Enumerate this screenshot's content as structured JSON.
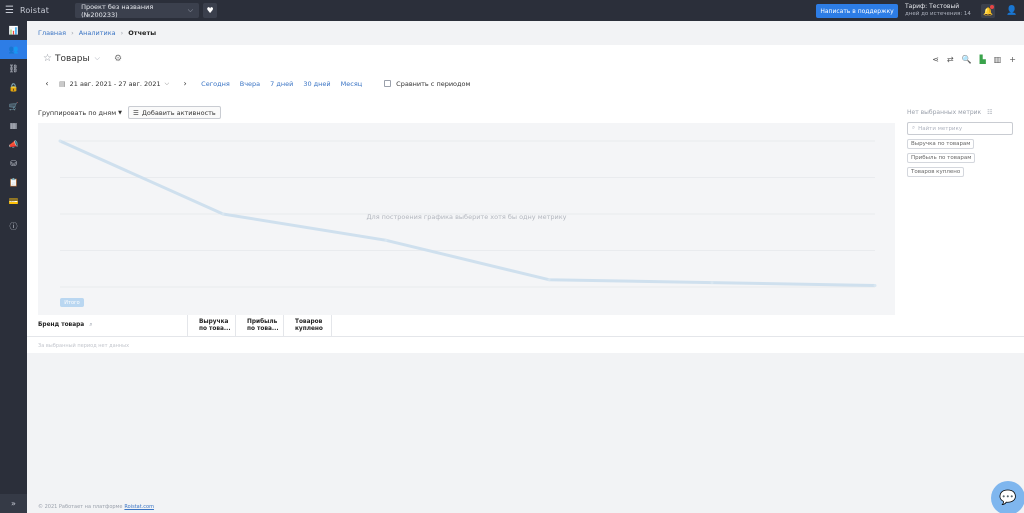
{
  "topbar": {
    "logo": "Roistat",
    "project": "Проект без названия (№200233)",
    "support_button": "Написать в поддержку",
    "tariff_title": "Тариф: Тестовый",
    "tariff_days": "дней до истечения: 14"
  },
  "sidebar": {
    "icons": [
      "analytics-icon",
      "user-group-icon",
      "sitemap-icon",
      "lock-icon",
      "cart-icon",
      "calendar-icon",
      "megaphone-icon",
      "database-icon",
      "table-edit-icon",
      "money-icon",
      "info-icon"
    ],
    "active_index": 1
  },
  "breadcrumb": {
    "home": "Главная",
    "analytics": "Аналитика",
    "current": "Отчеты"
  },
  "report": {
    "title": "Товары",
    "date_range": "21 авг. 2021 - 27 авг. 2021",
    "periods": [
      "Сегодня",
      "Вчера",
      "7 дней",
      "30 дней",
      "Месяц"
    ],
    "compare_label": "Сравнить с периодом",
    "group_by": "Группировать по дням",
    "add_activity": "Добавить активность"
  },
  "chart": {
    "message": "Для построения графика выберите хотя бы одну метрику",
    "tag": "Итого"
  },
  "chart_data": {
    "type": "line",
    "x": [
      1,
      2,
      3,
      4,
      5,
      6
    ],
    "values": [
      100,
      50,
      32,
      5,
      3,
      1
    ],
    "ylim": [
      0,
      100
    ]
  },
  "metrics": {
    "header": "Нет выбранных метрик",
    "search_placeholder": "Найти метрику",
    "items": [
      "Выручка по товарам",
      "Прибыль по товарам",
      "Товаров куплено"
    ]
  },
  "table": {
    "brand_column": "Бренд товара",
    "columns": [
      "Выручка по това...",
      "Прибыль по това...",
      "Товаров куплено"
    ],
    "empty": "За выбранный период нет данных"
  },
  "footer": {
    "text": "© 2021 Работает на платформе",
    "link": "Roistat.com"
  }
}
